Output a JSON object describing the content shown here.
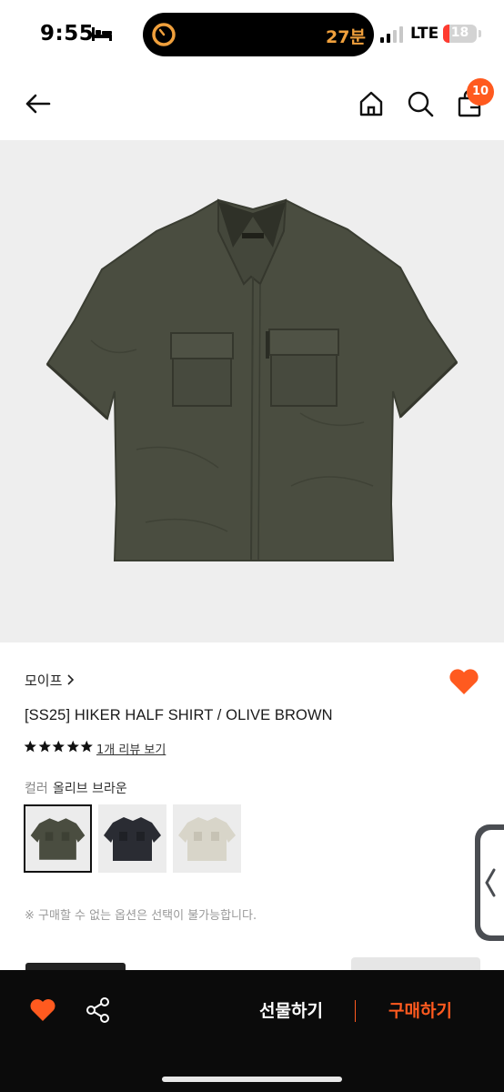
{
  "status_bar": {
    "time": "9:55",
    "island_text": "27분",
    "network": "LTE",
    "battery": "18",
    "battery_level": 0.18
  },
  "header": {
    "cart_count": "10",
    "icons": [
      "back-arrow-icon",
      "home-icon",
      "search-icon",
      "shopping-bag-icon"
    ]
  },
  "product": {
    "brand": "모이프",
    "title": "[SS25] HIKER HALF SHIRT / OLIVE BROWN",
    "rating": 5,
    "review_link": "1개 리뷰 보기",
    "option_label": "컬러",
    "option_value": "올리브 브라운",
    "swatches": [
      {
        "color": "#4a4d40",
        "selected": true
      },
      {
        "color": "#2a2c33",
        "selected": false
      },
      {
        "color": "#d8d5c9",
        "selected": false
      }
    ],
    "notice": "※ 구매할 수 없는 옵션은 선택이 불가능합니다."
  },
  "bottom_bar": {
    "gift_label": "선물하기",
    "buy_label": "구매하기"
  },
  "colors": {
    "accent": "#ff5a1f",
    "heart": "#ff5a1f",
    "bottom_bar": "#0b0b0b",
    "shirt": "#4a4d40"
  }
}
